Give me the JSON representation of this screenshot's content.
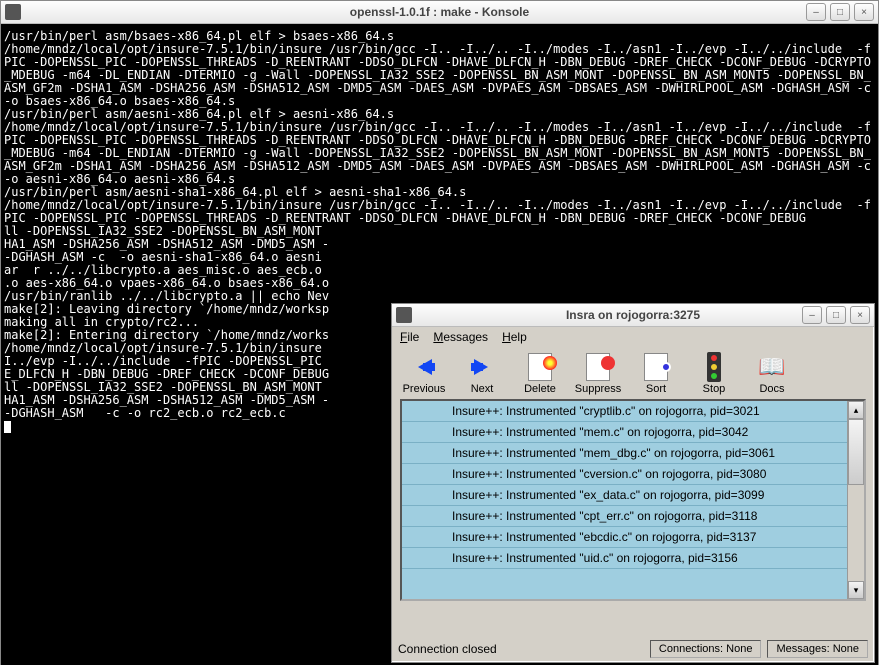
{
  "terminal": {
    "title": "openssl-1.0.1f : make - Konsole",
    "content": "/usr/bin/perl asm/bsaes-x86_64.pl elf > bsaes-x86_64.s\n/home/mndz/local/opt/insure-7.5.1/bin/insure /usr/bin/gcc -I.. -I../.. -I../modes -I../asn1 -I../evp -I../../include  -fPIC -DOPENSSL_PIC -DOPENSSL_THREADS -D_REENTRANT -DDSO_DLFCN -DHAVE_DLFCN_H -DBN_DEBUG -DREF_CHECK -DCONF_DEBUG -DCRYPTO_MDEBUG -m64 -DL_ENDIAN -DTERMIO -g -Wall -DOPENSSL_IA32_SSE2 -DOPENSSL_BN_ASM_MONT -DOPENSSL_BN_ASM_MONT5 -DOPENSSL_BN_ASM_GF2m -DSHA1_ASM -DSHA256_ASM -DSHA512_ASM -DMD5_ASM -DAES_ASM -DVPAES_ASM -DBSAES_ASM -DWHIRLPOOL_ASM -DGHASH_ASM -c  -o bsaes-x86_64.o bsaes-x86_64.s\n/usr/bin/perl asm/aesni-x86_64.pl elf > aesni-x86_64.s\n/home/mndz/local/opt/insure-7.5.1/bin/insure /usr/bin/gcc -I.. -I../.. -I../modes -I../asn1 -I../evp -I../../include  -fPIC -DOPENSSL_PIC -DOPENSSL_THREADS -D_REENTRANT -DDSO_DLFCN -DHAVE_DLFCN_H -DBN_DEBUG -DREF_CHECK -DCONF_DEBUG -DCRYPTO_MDEBUG -m64 -DL_ENDIAN -DTERMIO -g -Wall -DOPENSSL_IA32_SSE2 -DOPENSSL_BN_ASM_MONT -DOPENSSL_BN_ASM_MONT5 -DOPENSSL_BN_ASM_GF2m -DSHA1_ASM -DSHA256_ASM -DSHA512_ASM -DMD5_ASM -DAES_ASM -DVPAES_ASM -DBSAES_ASM -DWHIRLPOOL_ASM -DGHASH_ASM -c  -o aesni-x86_64.o aesni-x86_64.s\n/usr/bin/perl asm/aesni-sha1-x86_64.pl elf > aesni-sha1-x86_64.s\n/home/mndz/local/opt/insure-7.5.1/bin/insure /usr/bin/gcc -I.. -I../.. -I../modes -I../asn1 -I../evp -I../../include  -fPIC -DOPENSSL_PIC -DOPENSSL_THREADS -D_REENTRANT -DDSO_DLFCN -DHAVE_DLFCN_H -DBN_DEBUG -DREF_CHECK -DCONF_DEBUG\nll -DOPENSSL_IA32_SSE2 -DOPENSSL_BN_ASM_MONT\nHA1_ASM -DSHA256_ASM -DSHA512_ASM -DMD5_ASM -\n-DGHASH_ASM -c  -o aesni-sha1-x86_64.o aesni\nar  r ../../libcrypto.a aes_misc.o aes_ecb.o\n.o aes-x86_64.o vpaes-x86_64.o bsaes-x86_64.o\n/usr/bin/ranlib ../../libcrypto.a || echo Nev\nmake[2]: Leaving directory `/home/mndz/worksp\nmaking all in crypto/rc2...\nmake[2]: Entering directory `/home/mndz/works\n/home/mndz/local/opt/insure-7.5.1/bin/insure\nI../evp -I../../include  -fPIC -DOPENSSL_PIC\nE_DLFCN_H -DBN_DEBUG -DREF_CHECK -DCONF_DEBUG\nll -DOPENSSL_IA32_SSE2 -DOPENSSL_BN_ASM_MONT\nHA1_ASM -DSHA256_ASM -DSHA512_ASM -DMD5_ASM -\n-DGHASH_ASM   -c -o rc2_ecb.o rc2_ecb.c"
  },
  "insra": {
    "title": "Insra on rojogorra:3275",
    "menu": {
      "file": "File",
      "messages": "Messages",
      "help": "Help"
    },
    "toolbar": {
      "previous": "Previous",
      "next": "Next",
      "delete": "Delete",
      "suppress": "Suppress",
      "sort": "Sort",
      "stop": "Stop",
      "docs": "Docs"
    },
    "rows": [
      "Insure++: Instrumented \"cryptlib.c\" on rojogorra, pid=3021",
      "Insure++: Instrumented \"mem.c\" on rojogorra, pid=3042",
      "Insure++: Instrumented \"mem_dbg.c\" on rojogorra, pid=3061",
      "Insure++: Instrumented \"cversion.c\" on rojogorra, pid=3080",
      "Insure++: Instrumented \"ex_data.c\" on rojogorra, pid=3099",
      "Insure++: Instrumented \"cpt_err.c\" on rojogorra, pid=3118",
      "Insure++: Instrumented \"ebcdic.c\" on rojogorra, pid=3137",
      "Insure++: Instrumented \"uid.c\" on rojogorra, pid=3156"
    ],
    "status": {
      "left": "Connection closed",
      "connections": "Connections: None",
      "messages": "Messages: None"
    }
  }
}
